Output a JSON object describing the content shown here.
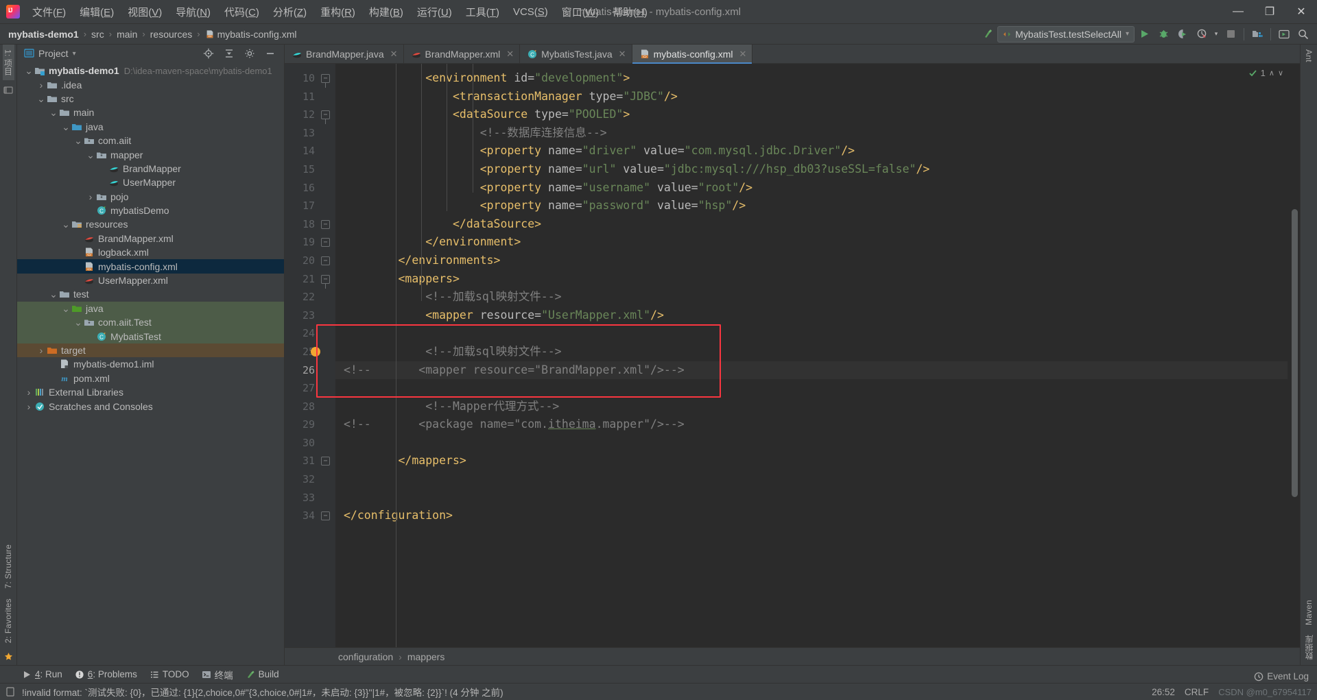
{
  "window": {
    "title": "mybatis-demo1 - mybatis-config.xml",
    "minimize": "—",
    "maximize": "❐",
    "close": "✕"
  },
  "menu": [
    {
      "label": "文件(F)"
    },
    {
      "label": "编辑(E)"
    },
    {
      "label": "视图(V)"
    },
    {
      "label": "导航(N)"
    },
    {
      "label": "代码(C)"
    },
    {
      "label": "分析(Z)"
    },
    {
      "label": "重构(R)"
    },
    {
      "label": "构建(B)"
    },
    {
      "label": "运行(U)"
    },
    {
      "label": "工具(T)"
    },
    {
      "label": "VCS(S)"
    },
    {
      "label": "窗口(W)"
    },
    {
      "label": "帮助(H)"
    }
  ],
  "breadcrumb": {
    "items": [
      "mybatis-demo1",
      "src",
      "main",
      "resources",
      "mybatis-config.xml"
    ],
    "separator": "›"
  },
  "toolbar": {
    "run_config": "MybatisTest.testSelectAll",
    "run_config_dropdown": "▾",
    "build_label": "build-icon",
    "run_label": "run-icon",
    "debug_label": "debug-icon",
    "coverage_label": "run-with-coverage-icon",
    "profiler_label": "profiler-icon",
    "stop_label": "stop-icon",
    "project_structure_label": "project-structure-icon",
    "updates_label": "updates-icon",
    "search_label": "search-everywhere-icon"
  },
  "left_strip": {
    "top": [
      "1: 项目"
    ],
    "bottom": [
      "7: Structure",
      "2: Favorites"
    ]
  },
  "right_strip": {
    "top": [
      "Ant"
    ],
    "bottom": [
      "Maven",
      "数据库"
    ]
  },
  "project_panel": {
    "title": "Project",
    "dropdown": "▾",
    "locate_icon": "locate-icon",
    "collapse_icon": "collapse-all-icon",
    "hide_icon": "hide-icon",
    "settings_icon": "gear-icon",
    "tree": [
      {
        "depth": 0,
        "twist": "v",
        "icon": "module",
        "label": "mybatis-demo1",
        "bold": true,
        "path": "D:\\idea-maven-space\\mybatis-demo1",
        "state": "none"
      },
      {
        "depth": 1,
        "twist": ">",
        "icon": "folder",
        "label": ".idea",
        "state": "none"
      },
      {
        "depth": 1,
        "twist": "v",
        "icon": "folder",
        "label": "src",
        "state": "none"
      },
      {
        "depth": 2,
        "twist": "v",
        "icon": "folder",
        "label": "main",
        "state": "none"
      },
      {
        "depth": 3,
        "twist": "v",
        "icon": "source-folder",
        "label": "java",
        "state": "none"
      },
      {
        "depth": 4,
        "twist": "v",
        "icon": "package",
        "label": "com.aiit",
        "state": "none"
      },
      {
        "depth": 5,
        "twist": "v",
        "icon": "package",
        "label": "mapper",
        "state": "none"
      },
      {
        "depth": 6,
        "twist": "",
        "icon": "interface",
        "label": "BrandMapper",
        "state": "none"
      },
      {
        "depth": 6,
        "twist": "",
        "icon": "interface",
        "label": "UserMapper",
        "state": "none"
      },
      {
        "depth": 5,
        "twist": ">",
        "icon": "package",
        "label": "pojo",
        "state": "none"
      },
      {
        "depth": 5,
        "twist": "",
        "icon": "class",
        "label": "mybatisDemo",
        "state": "none"
      },
      {
        "depth": 3,
        "twist": "v",
        "icon": "resource-folder",
        "label": "resources",
        "state": "none"
      },
      {
        "depth": 4,
        "twist": "",
        "icon": "mapper-xml",
        "label": "BrandMapper.xml",
        "state": "none"
      },
      {
        "depth": 4,
        "twist": "",
        "icon": "xml",
        "label": "logback.xml",
        "state": "none"
      },
      {
        "depth": 4,
        "twist": "",
        "icon": "xml",
        "label": "mybatis-config.xml",
        "state": "selected"
      },
      {
        "depth": 4,
        "twist": "",
        "icon": "mapper-xml",
        "label": "UserMapper.xml",
        "state": "none"
      },
      {
        "depth": 2,
        "twist": "v",
        "icon": "folder",
        "label": "test",
        "state": "none"
      },
      {
        "depth": 3,
        "twist": "v",
        "icon": "test-source-folder",
        "label": "java",
        "state": "green"
      },
      {
        "depth": 4,
        "twist": "v",
        "icon": "package",
        "label": "com.aiit.Test",
        "state": "green"
      },
      {
        "depth": 5,
        "twist": "",
        "icon": "test-class",
        "label": "MybatisTest",
        "state": "green"
      },
      {
        "depth": 1,
        "twist": ">",
        "icon": "excluded-folder",
        "label": "target",
        "state": "orange"
      },
      {
        "depth": 2,
        "twist": "",
        "icon": "iml",
        "label": "mybatis-demo1.iml",
        "state": "none"
      },
      {
        "depth": 2,
        "twist": "",
        "icon": "maven",
        "label": "pom.xml",
        "state": "none"
      },
      {
        "depth": 0,
        "twist": ">",
        "icon": "libraries",
        "label": "External Libraries",
        "state": "none"
      },
      {
        "depth": 0,
        "twist": ">",
        "icon": "scratches",
        "label": "Scratches and Consoles",
        "state": "none"
      }
    ]
  },
  "editor": {
    "tabs": [
      {
        "label": "BrandMapper.java",
        "icon": "interface",
        "active": false,
        "close": "✕"
      },
      {
        "label": "BrandMapper.xml",
        "icon": "mapper-xml",
        "active": false,
        "close": "✕"
      },
      {
        "label": "MybatisTest.java",
        "icon": "test-class",
        "active": false,
        "close": "✕"
      },
      {
        "label": "mybatis-config.xml",
        "icon": "xml",
        "active": true,
        "close": "✕"
      }
    ],
    "inspection_count": "1",
    "inspection_up": "∧",
    "inspection_down": "∨",
    "first_line": 10,
    "current_line": 26,
    "lines": [
      {
        "n": 10,
        "fold": "minus",
        "tokens": [
          {
            "t": "            ",
            "c": "pl"
          },
          {
            "t": "<environment ",
            "c": "k"
          },
          {
            "t": "id=",
            "c": "at"
          },
          {
            "t": "\"development\"",
            "c": "st"
          },
          {
            "t": ">",
            "c": "k"
          }
        ]
      },
      {
        "n": 11,
        "fold": "",
        "tokens": [
          {
            "t": "                ",
            "c": "pl"
          },
          {
            "t": "<transactionManager ",
            "c": "k"
          },
          {
            "t": "type=",
            "c": "at"
          },
          {
            "t": "\"JDBC\"",
            "c": "st"
          },
          {
            "t": "/>",
            "c": "k"
          }
        ]
      },
      {
        "n": 12,
        "fold": "minus",
        "tokens": [
          {
            "t": "                ",
            "c": "pl"
          },
          {
            "t": "<dataSource ",
            "c": "k"
          },
          {
            "t": "type=",
            "c": "at"
          },
          {
            "t": "\"POOLED\"",
            "c": "st"
          },
          {
            "t": ">",
            "c": "k"
          }
        ]
      },
      {
        "n": 13,
        "fold": "",
        "tokens": [
          {
            "t": "                    ",
            "c": "pl"
          },
          {
            "t": "<!--数据库连接信息-->",
            "c": "cm"
          }
        ]
      },
      {
        "n": 14,
        "fold": "",
        "tokens": [
          {
            "t": "                    ",
            "c": "pl"
          },
          {
            "t": "<property ",
            "c": "k"
          },
          {
            "t": "name=",
            "c": "at"
          },
          {
            "t": "\"driver\"",
            "c": "st"
          },
          {
            "t": " value=",
            "c": "at"
          },
          {
            "t": "\"com.mysql.jdbc.Driver\"",
            "c": "st"
          },
          {
            "t": "/>",
            "c": "k"
          }
        ]
      },
      {
        "n": 15,
        "fold": "",
        "tokens": [
          {
            "t": "                    ",
            "c": "pl"
          },
          {
            "t": "<property ",
            "c": "k"
          },
          {
            "t": "name=",
            "c": "at"
          },
          {
            "t": "\"url\"",
            "c": "st"
          },
          {
            "t": " value=",
            "c": "at"
          },
          {
            "t": "\"jdbc:mysql:///hsp_db03?useSSL=false\"",
            "c": "st"
          },
          {
            "t": "/>",
            "c": "k"
          }
        ]
      },
      {
        "n": 16,
        "fold": "",
        "tokens": [
          {
            "t": "                    ",
            "c": "pl"
          },
          {
            "t": "<property ",
            "c": "k"
          },
          {
            "t": "name=",
            "c": "at"
          },
          {
            "t": "\"username\"",
            "c": "st"
          },
          {
            "t": " value=",
            "c": "at"
          },
          {
            "t": "\"root\"",
            "c": "st"
          },
          {
            "t": "/>",
            "c": "k"
          }
        ]
      },
      {
        "n": 17,
        "fold": "",
        "tokens": [
          {
            "t": "                    ",
            "c": "pl"
          },
          {
            "t": "<property ",
            "c": "k"
          },
          {
            "t": "name=",
            "c": "at"
          },
          {
            "t": "\"password\"",
            "c": "st"
          },
          {
            "t": " value=",
            "c": "at"
          },
          {
            "t": "\"hsp\"",
            "c": "st"
          },
          {
            "t": "/>",
            "c": "k"
          }
        ]
      },
      {
        "n": 18,
        "fold": "end",
        "tokens": [
          {
            "t": "                ",
            "c": "pl"
          },
          {
            "t": "</dataSource>",
            "c": "k"
          }
        ]
      },
      {
        "n": 19,
        "fold": "end",
        "tokens": [
          {
            "t": "            ",
            "c": "pl"
          },
          {
            "t": "</environment>",
            "c": "k"
          }
        ]
      },
      {
        "n": 20,
        "fold": "end",
        "tokens": [
          {
            "t": "        ",
            "c": "pl"
          },
          {
            "t": "</environments>",
            "c": "k"
          }
        ]
      },
      {
        "n": 21,
        "fold": "minus",
        "tokens": [
          {
            "t": "        ",
            "c": "pl"
          },
          {
            "t": "<mappers>",
            "c": "k"
          }
        ]
      },
      {
        "n": 22,
        "fold": "",
        "tokens": [
          {
            "t": "            ",
            "c": "pl"
          },
          {
            "t": "<!--加载sql映射文件-->",
            "c": "cm"
          }
        ]
      },
      {
        "n": 23,
        "fold": "",
        "tokens": [
          {
            "t": "            ",
            "c": "pl"
          },
          {
            "t": "<mapper ",
            "c": "k"
          },
          {
            "t": "resource=",
            "c": "at"
          },
          {
            "t": "\"UserMapper.xml\"",
            "c": "st"
          },
          {
            "t": "/>",
            "c": "k"
          }
        ]
      },
      {
        "n": 24,
        "fold": "",
        "tokens": [
          {
            "t": "",
            "c": "pl"
          }
        ]
      },
      {
        "n": 25,
        "fold": "",
        "bulb": true,
        "tokens": [
          {
            "t": "            ",
            "c": "pl"
          },
          {
            "t": "<!--加载sql映射文件-->",
            "c": "cm"
          }
        ]
      },
      {
        "n": 26,
        "fold": "",
        "current": true,
        "tokens": [
          {
            "t": "",
            "c": "pl"
          },
          {
            "t": "<!--       <mapper resource=\"BrandMapper.xml\"/>-->",
            "c": "cm"
          }
        ]
      },
      {
        "n": 27,
        "fold": "",
        "tokens": [
          {
            "t": "",
            "c": "pl"
          }
        ]
      },
      {
        "n": 28,
        "fold": "",
        "tokens": [
          {
            "t": "            ",
            "c": "pl"
          },
          {
            "t": "<!--Mapper代理方式-->",
            "c": "cm"
          }
        ]
      },
      {
        "n": 29,
        "fold": "",
        "tokens": [
          {
            "t": "",
            "c": "pl"
          },
          {
            "t": "<!--       <package name=\"com.",
            "c": "cm"
          },
          {
            "t": "itheima",
            "c": "cm ul"
          },
          {
            "t": ".mapper\"/>-->",
            "c": "cm"
          }
        ]
      },
      {
        "n": 30,
        "fold": "",
        "tokens": [
          {
            "t": "",
            "c": "pl"
          }
        ]
      },
      {
        "n": 31,
        "fold": "end",
        "tokens": [
          {
            "t": "        ",
            "c": "pl"
          },
          {
            "t": "</mappers>",
            "c": "k"
          }
        ]
      },
      {
        "n": 32,
        "fold": "",
        "tokens": [
          {
            "t": "",
            "c": "pl"
          }
        ]
      },
      {
        "n": 33,
        "fold": "",
        "tokens": [
          {
            "t": "",
            "c": "pl"
          }
        ]
      },
      {
        "n": 34,
        "fold": "end",
        "tokens": [
          {
            "t": "",
            "c": "pl"
          },
          {
            "t": "</configuration>",
            "c": "k"
          }
        ]
      }
    ],
    "annotation_box": {
      "color": "#fb3640",
      "label": "highlight-box"
    },
    "crumb": [
      "configuration",
      "mappers"
    ],
    "crumb_separator": "›"
  },
  "bottom_bar": [
    {
      "icon": "run-icon",
      "label": "4: Run"
    },
    {
      "icon": "problems-icon",
      "label": "6: Problems"
    },
    {
      "icon": "todo-icon",
      "label": "TODO"
    },
    {
      "icon": "terminal-icon",
      "label": "终端"
    },
    {
      "icon": "build-icon",
      "label": "Build"
    }
  ],
  "status_bar": {
    "message": "!invalid format: `测试失败: {0}，已通过: {1}{2,choice,0#''{3,choice,0#|1#，未启动: {3}}''|1#，被忽略: {2}}`! (4 分钟 之前)",
    "position": "26:52",
    "line_sep": "CRLF",
    "event_log": "Event Log",
    "watermark": "CSDN @m0_67954117"
  },
  "colors": {
    "accent_blue": "#4a88c7",
    "selection": "#0d293e",
    "test_green": "#4d5c48",
    "excluded_orange": "#5b4a33",
    "box_red": "#fb3640",
    "tag": "#e8bf6a",
    "string": "#6a8759",
    "comment": "#808080",
    "attr": "#bababa"
  }
}
